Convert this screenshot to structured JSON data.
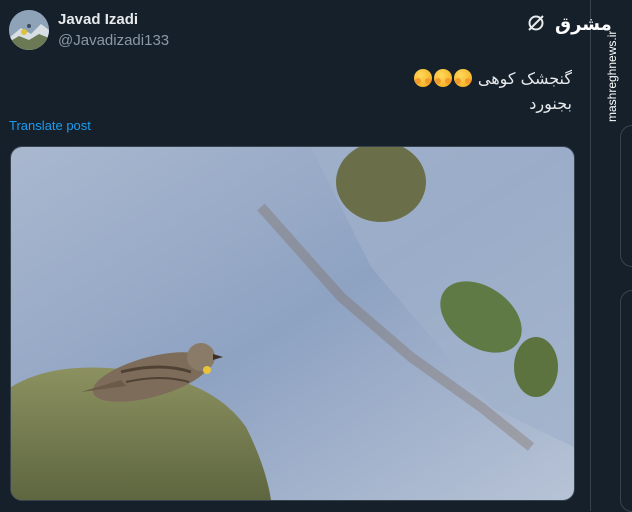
{
  "tweet": {
    "author_name": "Javad Izadi",
    "author_handle": "@Javadizadi133",
    "text_line1": "گنجشک کوهی",
    "text_line2": "بجنورد",
    "emoji_count": 3,
    "translate_label": "Translate post"
  },
  "watermark": {
    "logo_text": "مشرق",
    "site": "mashreghnews.ir"
  },
  "colors": {
    "background": "#15202b",
    "link": "#1d9bf0",
    "secondary_text": "#8b98a5"
  }
}
